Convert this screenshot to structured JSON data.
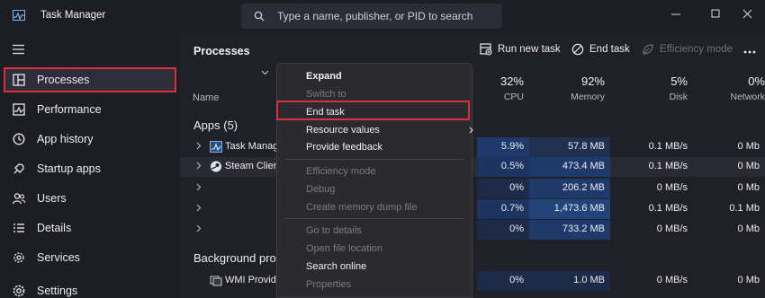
{
  "window": {
    "title": "Task Manager"
  },
  "search": {
    "placeholder": "Type a name, publisher, or PID to search"
  },
  "sidebar": {
    "items": [
      {
        "label": "Processes",
        "icon": "processes-icon",
        "active": true
      },
      {
        "label": "Performance",
        "icon": "performance-icon"
      },
      {
        "label": "App history",
        "icon": "app-history-icon"
      },
      {
        "label": "Startup apps",
        "icon": "startup-apps-icon"
      },
      {
        "label": "Users",
        "icon": "users-icon"
      },
      {
        "label": "Details",
        "icon": "details-icon"
      },
      {
        "label": "Services",
        "icon": "services-icon"
      },
      {
        "label": "Settings",
        "icon": "settings-icon"
      }
    ]
  },
  "main": {
    "title": "Processes",
    "toolbar": {
      "run_new_task": "Run new task",
      "end_task": "End task",
      "efficiency_mode": "Efficiency mode"
    },
    "columns": {
      "name": "Name",
      "cpu": {
        "pct": "32%",
        "label": "CPU"
      },
      "memory": {
        "pct": "92%",
        "label": "Memory"
      },
      "disk": {
        "pct": "5%",
        "label": "Disk"
      },
      "network": {
        "pct": "0%",
        "label": "Network"
      }
    },
    "apps_header": "Apps (5)",
    "background_header": "Background pro",
    "rows": [
      {
        "name": "Task Manage",
        "cpu": "5.9%",
        "memory": "57.8 MB",
        "disk": "0.1 MB/s",
        "network": "0 Mb"
      },
      {
        "name": "Steam Client",
        "cpu": "0.5%",
        "memory": "473.4 MB",
        "disk": "0.1 MB/s",
        "network": "0 Mb"
      },
      {
        "name": "",
        "cpu": "0%",
        "memory": "206.2 MB",
        "disk": "0 MB/s",
        "network": "0 Mb"
      },
      {
        "name": "",
        "cpu": "0.7%",
        "memory": "1,473.6 MB",
        "disk": "0.1 MB/s",
        "network": "0.1 Mb"
      },
      {
        "name": "",
        "cpu": "0%",
        "memory": "733.2 MB",
        "disk": "0 MB/s",
        "network": "0 Mb"
      },
      {
        "name": "WMI Provide",
        "cpu": "0%",
        "memory": "1.0 MB",
        "disk": "0 MB/s",
        "network": "0 Mb"
      }
    ]
  },
  "context_menu": {
    "items": [
      {
        "label": "Expand"
      },
      {
        "label": "Switch to"
      },
      {
        "label": "End task"
      },
      {
        "label": "Resource values"
      },
      {
        "label": "Provide feedback"
      },
      {
        "label": "Efficiency mode"
      },
      {
        "label": "Debug"
      },
      {
        "label": "Create memory dump file"
      },
      {
        "label": "Go to details"
      },
      {
        "label": "Open file location"
      },
      {
        "label": "Search online"
      },
      {
        "label": "Properties"
      }
    ]
  },
  "colors": {
    "highlight_outline": "#d9303b",
    "cell_blue": "#1f3a6a",
    "cell_blue_light": "#203150"
  }
}
